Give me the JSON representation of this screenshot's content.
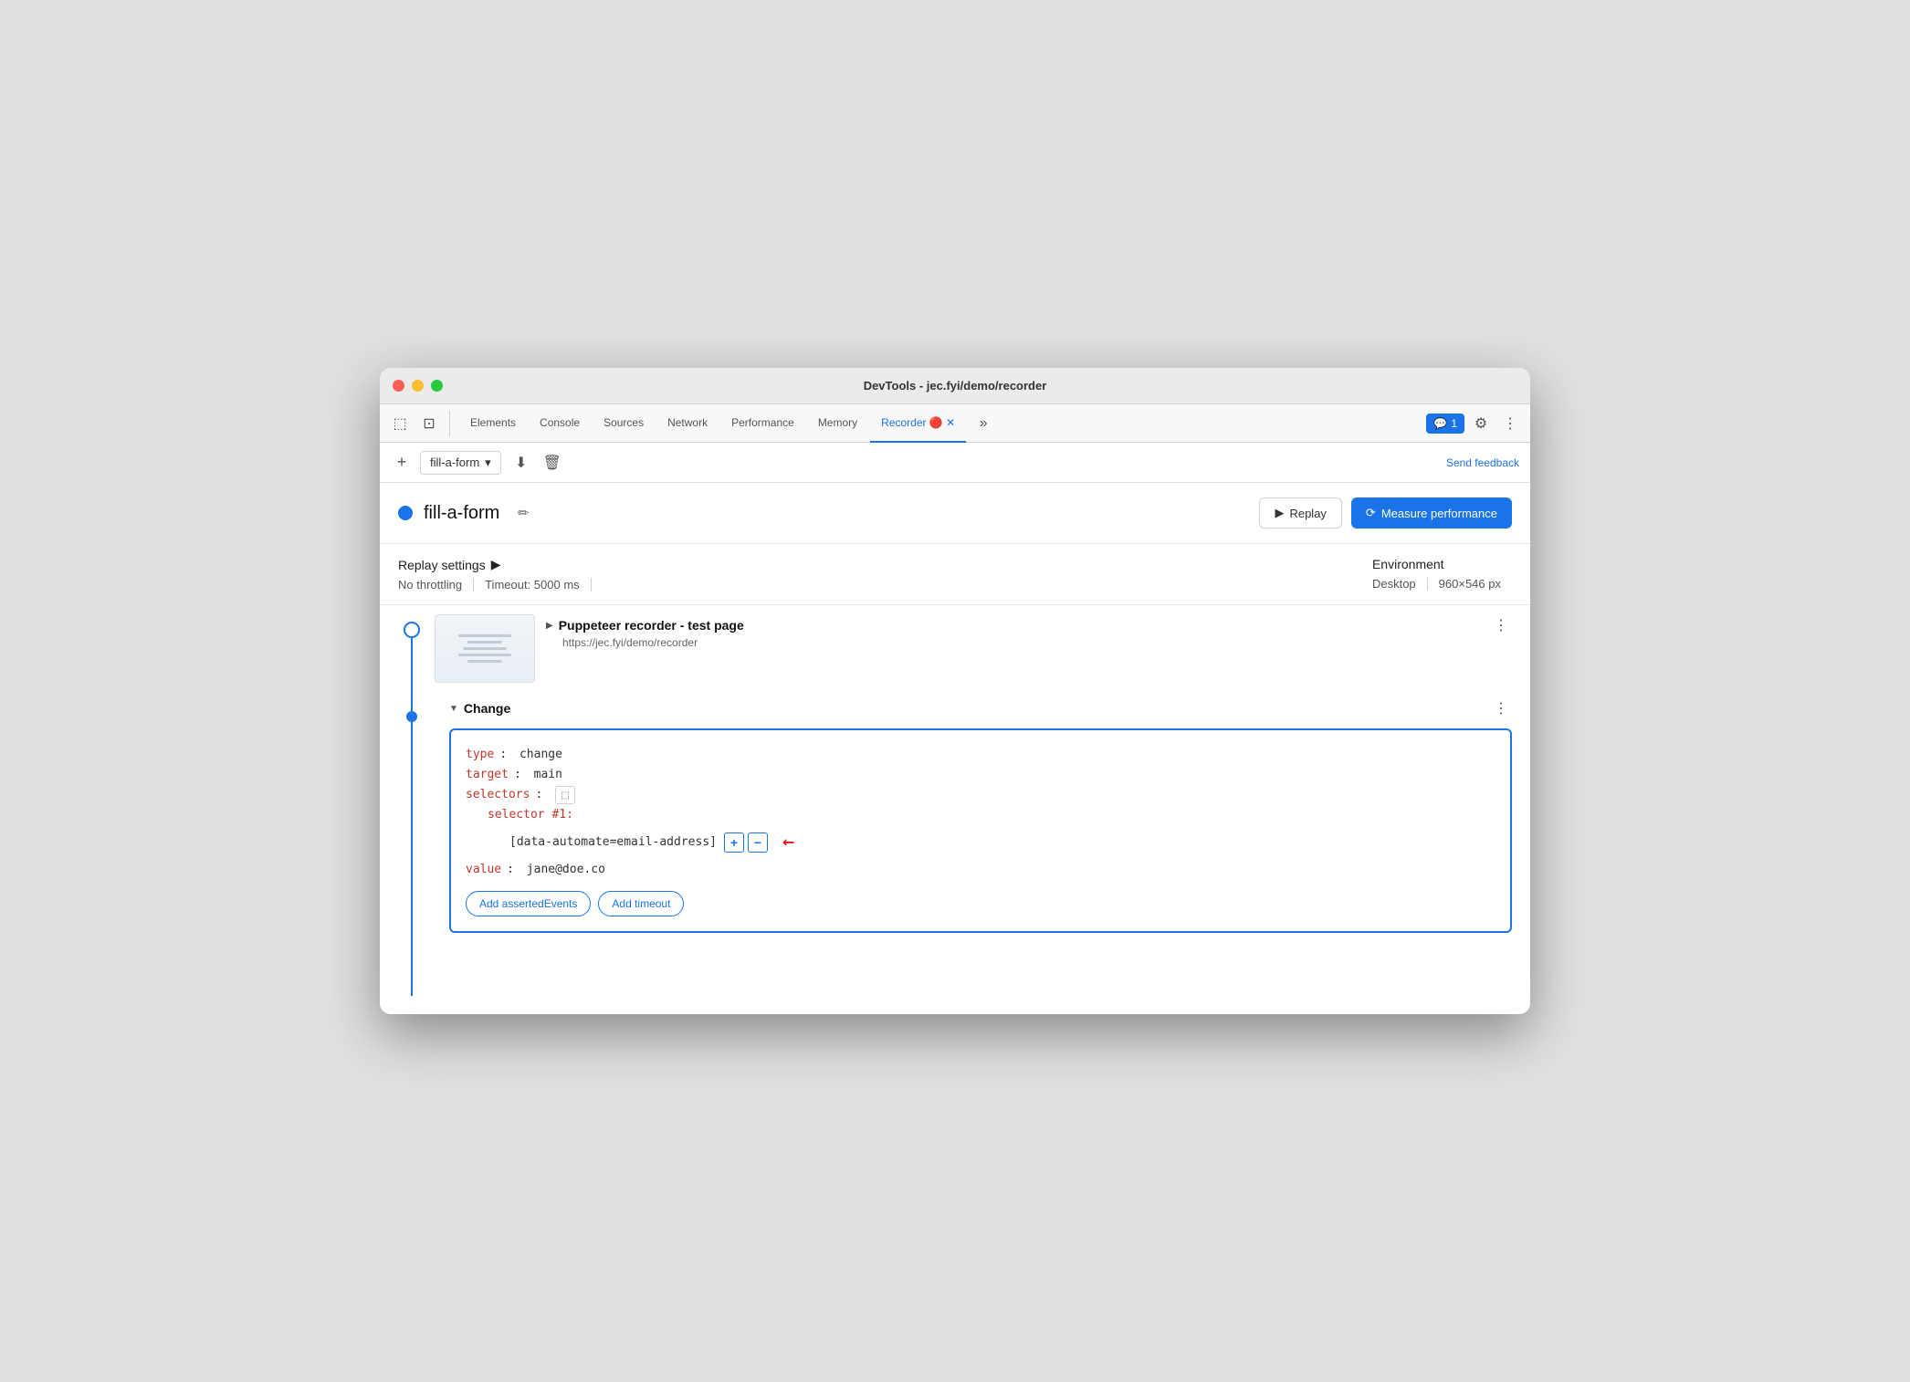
{
  "window": {
    "title": "DevTools - jec.fyi/demo/recorder"
  },
  "tabs": {
    "items": [
      {
        "id": "elements",
        "label": "Elements",
        "active": false
      },
      {
        "id": "console",
        "label": "Console",
        "active": false
      },
      {
        "id": "sources",
        "label": "Sources",
        "active": false
      },
      {
        "id": "network",
        "label": "Network",
        "active": false
      },
      {
        "id": "performance",
        "label": "Performance",
        "active": false
      },
      {
        "id": "memory",
        "label": "Memory",
        "active": false
      },
      {
        "id": "recorder",
        "label": "Recorder",
        "active": true
      }
    ],
    "badge": {
      "icon": "💬",
      "count": "1"
    },
    "more": "›› "
  },
  "recorder_toolbar": {
    "add_label": "+",
    "recording_name": "fill-a-form",
    "download_label": "⬇",
    "delete_label": "🗑",
    "send_feedback_label": "Send feedback"
  },
  "recording_header": {
    "title": "fill-a-form",
    "edit_icon": "✏",
    "replay_label": "Replay",
    "measure_label": "Measure performance"
  },
  "settings": {
    "title": "Replay settings",
    "throttle": "No throttling",
    "timeout": "Timeout: 5000 ms",
    "env_title": "Environment",
    "desktop": "Desktop",
    "resolution": "960×546 px"
  },
  "steps": {
    "puppeteer": {
      "title": "Puppeteer recorder - test page",
      "url": "https://jec.fyi/demo/recorder"
    },
    "change": {
      "title": "Change",
      "code": {
        "type_key": "type",
        "type_val": "change",
        "target_key": "target",
        "target_val": "main",
        "selectors_key": "selectors",
        "selector_num": "selector #1:",
        "selector_val": "[data-automate=email-address]",
        "value_key": "value",
        "value_val": "jane@doe.co"
      },
      "add_asserted_label": "Add assertedEvents",
      "add_timeout_label": "Add timeout"
    }
  }
}
